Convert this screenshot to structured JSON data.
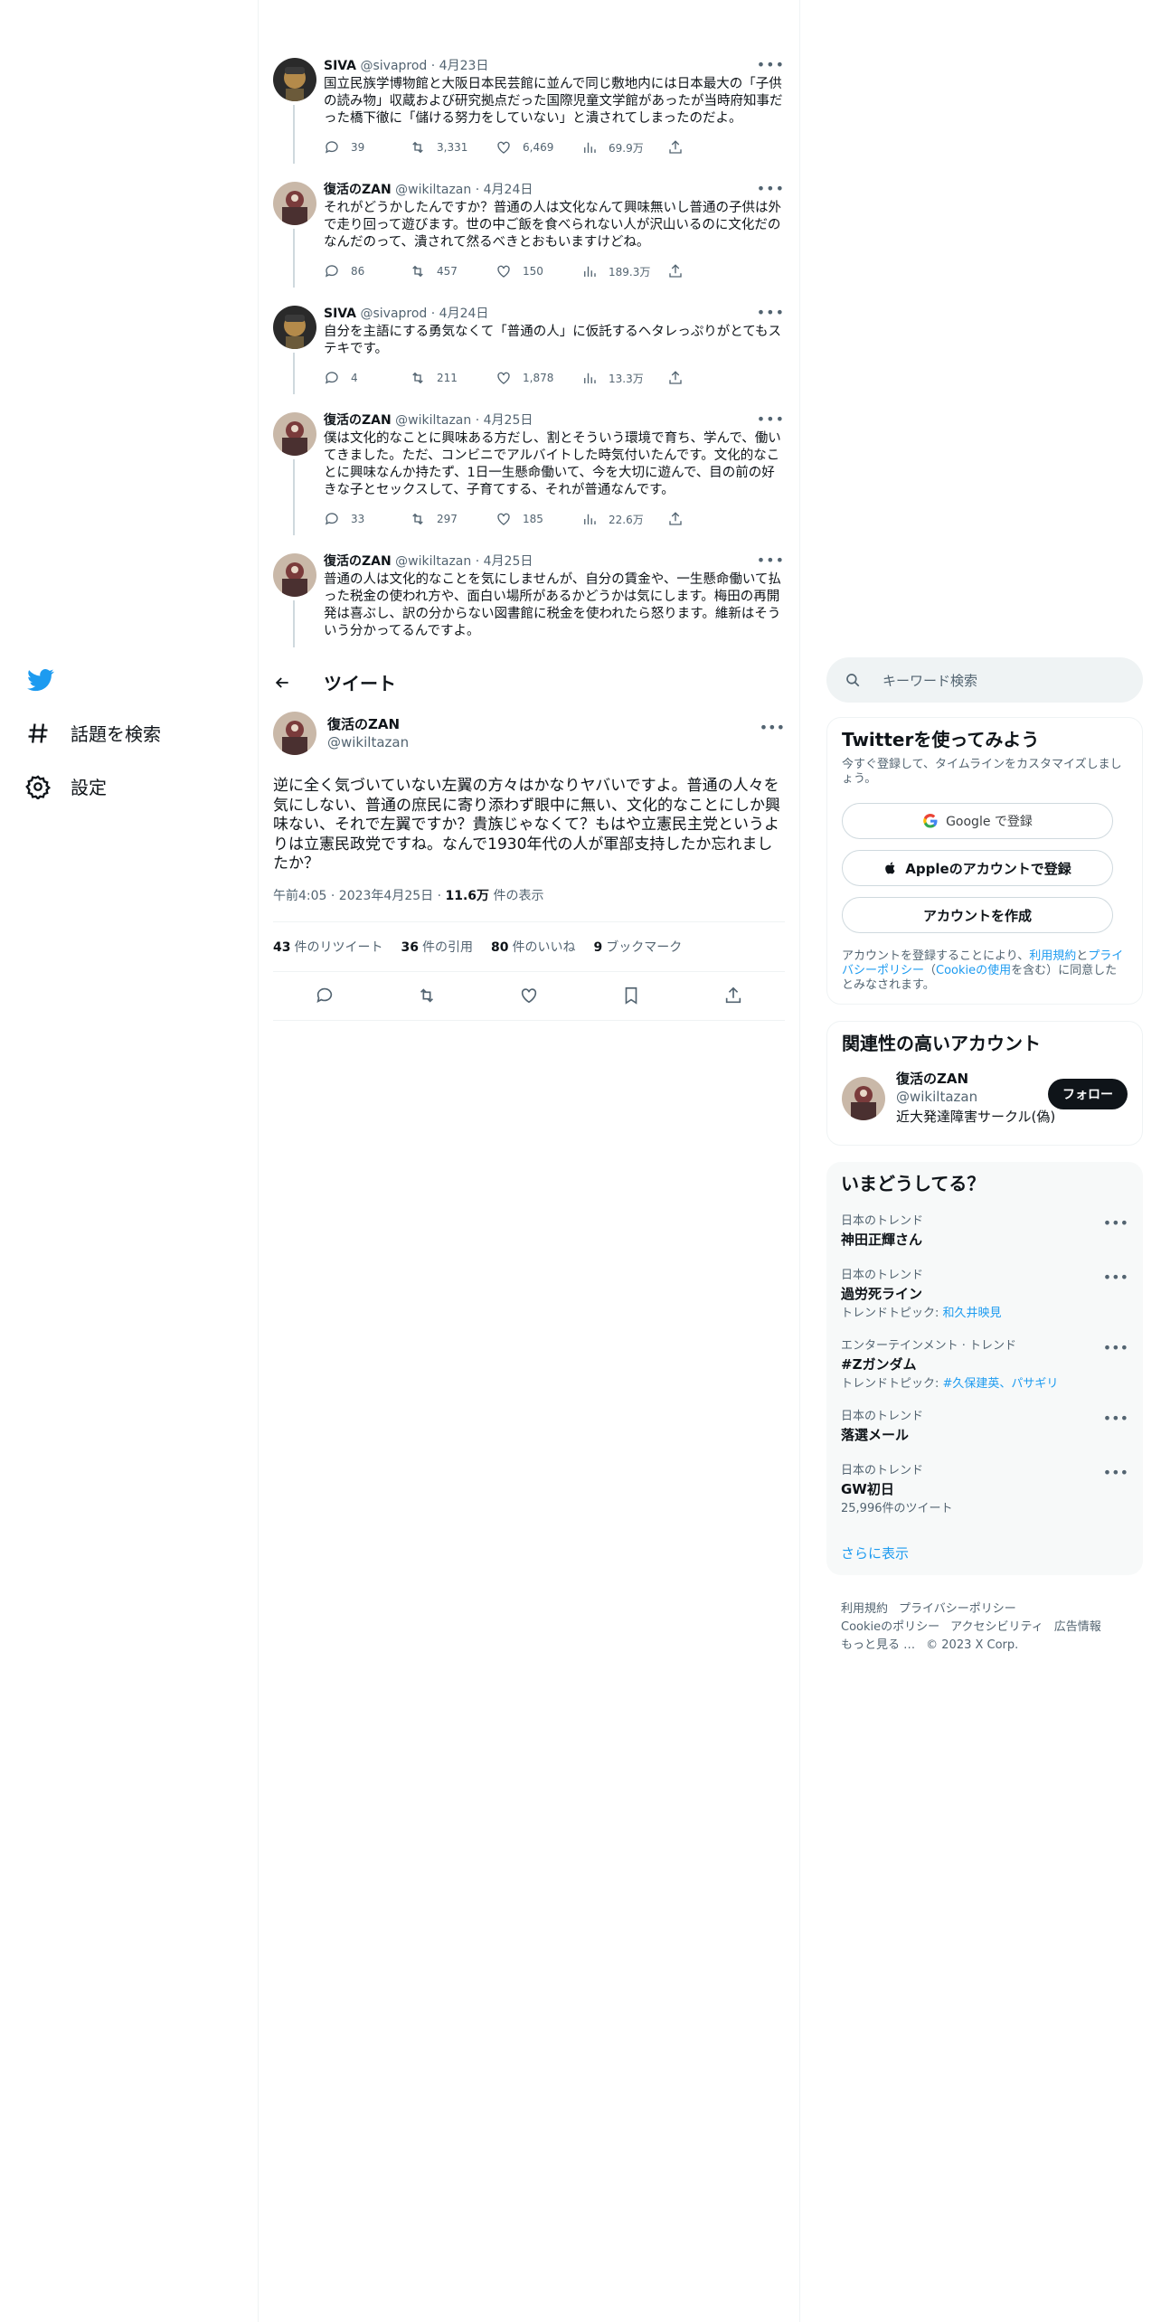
{
  "nav": {
    "items": [
      {
        "label": "話題を検索",
        "icon": "hashtag-icon"
      },
      {
        "label": "設定",
        "icon": "gear-icon"
      }
    ]
  },
  "thread": [
    {
      "name": "SIVA",
      "handle": "@sivaprod",
      "date": "4月23日",
      "text": "国立民族学博物館と大阪日本民芸館に並んで同じ敷地内には日本最大の「子供の読み物」収蔵および研究拠点だった国際児童文学館があったが当時府知事だった橋下徹に「儲ける努力をしていない」と潰されてしまったのだよ。",
      "reply": "39",
      "retweet": "3,331",
      "like": "6,469",
      "views": "69.9万"
    },
    {
      "name": "復活のZAN",
      "handle": "@wikiltazan",
      "date": "4月24日",
      "text": "それがどうかしたんですか？普通の人は文化なんて興味無いし普通の子供は外で走り回って遊びます。世の中ご飯を食べられない人が沢山いるのに文化だのなんだのって、潰されて然るべきとおもいますけどね。",
      "reply": "86",
      "retweet": "457",
      "like": "150",
      "views": "189.3万"
    },
    {
      "name": "SIVA",
      "handle": "@sivaprod",
      "date": "4月24日",
      "text": "自分を主語にする勇気なくて「普通の人」に仮託するヘタレっぷりがとてもステキです。",
      "reply": "4",
      "retweet": "211",
      "like": "1,878",
      "views": "13.3万"
    },
    {
      "name": "復活のZAN",
      "handle": "@wikiltazan",
      "date": "4月25日",
      "text": "僕は文化的なことに興味ある方だし、割とそういう環境で育ち、学んで、働いてきました。ただ、コンビニでアルバイトした時気付いたんです。文化的なことに興味なんか持たず、1日一生懸命働いて、今を大切に遊んで、目の前の好きな子とセックスして、子育てする、それが普通なんです。",
      "reply": "33",
      "retweet": "297",
      "like": "185",
      "views": "22.6万"
    },
    {
      "name": "復活のZAN",
      "handle": "@wikiltazan",
      "date": "4月25日",
      "text": "普通の人は文化的なことを気にしませんが、自分の賃金や、一生懸命働いて払った税金の使われ方や、面白い場所があるかどうかは気にします。梅田の再開発は喜ぶし、訳の分からない図書館に税金を使われたら怒ります。維新はそういう分かってるんですよ。",
      "reply": "",
      "retweet": "",
      "like": "",
      "views": ""
    }
  ],
  "header": {
    "title": "ツイート"
  },
  "detail": {
    "name": "復活のZAN",
    "handle": "@wikiltazan",
    "text": "逆に全く気づいていない左翼の方々はかなりヤバいですよ。普通の人々を気にしない、普通の庶民に寄り添わず眼中に無い、文化的なことにしか興味ない、それで左翼ですか？貴族じゃなくて？もはや立憲民主党というよりは立憲民政党ですね。なんで1930年代の人が軍部支持したか忘れましたか？",
    "time": "午前4:05 · 2023年4月25日 · ",
    "views_num": "11.6万",
    "views_label": " 件の表示",
    "stats": [
      {
        "num": "43",
        "label": "件のリツイート"
      },
      {
        "num": "36",
        "label": "件の引用"
      },
      {
        "num": "80",
        "label": "件のいいね"
      },
      {
        "num": "9",
        "label": "ブックマーク"
      }
    ]
  },
  "search": {
    "placeholder": "キーワード検索"
  },
  "signup": {
    "title": "Twitterを使ってみよう",
    "sub": "今すぐ登録して、タイムラインをカスタマイズしましょう。",
    "google": "Google で登録",
    "apple": "Appleのアカウントで登録",
    "create": "アカウントを作成",
    "legal_pre": "アカウントを登録することにより、",
    "legal_link1": "利用規約",
    "legal_mid1": "と",
    "legal_link2": "プライバシーポリシー",
    "legal_mid2": "（",
    "legal_link3": "Cookieの使用",
    "legal_post": "を含む）に同意したとみなされます。"
  },
  "related": {
    "title": "関連性の高いアカウント",
    "name": "復活のZAN",
    "handle": "@wikiltazan",
    "bio": "近大発達障害サークル(偽)",
    "follow": "フォロー"
  },
  "trends": {
    "title": "いまどうしてる？",
    "items": [
      {
        "ctx": "日本のトレンド",
        "name": "神田正輝さん",
        "extra_pre": "",
        "extra_link": ""
      },
      {
        "ctx": "日本のトレンド",
        "name": "過労死ライン",
        "extra_pre": "トレンドトピック: ",
        "extra_link": "和久井映見"
      },
      {
        "ctx": "エンターテインメント · トレンド",
        "name": "#Zガンダム",
        "extra_pre": "トレンドトピック: ",
        "extra_link": "#久保建英、パサギリ"
      },
      {
        "ctx": "日本のトレンド",
        "name": "落選メール",
        "extra_pre": "",
        "extra_link": ""
      },
      {
        "ctx": "日本のトレンド",
        "name": "GW初日",
        "extra_pre": "25,996件のツイート",
        "extra_link": ""
      }
    ],
    "show_more": "さらに表示"
  },
  "footer": {
    "line1": [
      "利用規約",
      "プライバシーポリシー"
    ],
    "line2": [
      "Cookieのポリシー",
      "アクセシビリティ",
      "広告情報"
    ],
    "line3": [
      "もっと見る …",
      "© 2023 X Corp."
    ]
  },
  "colors": {
    "accent": "#1d9bf0",
    "text": "#0f1419",
    "muted": "#536471",
    "border": "#eff3f4"
  }
}
